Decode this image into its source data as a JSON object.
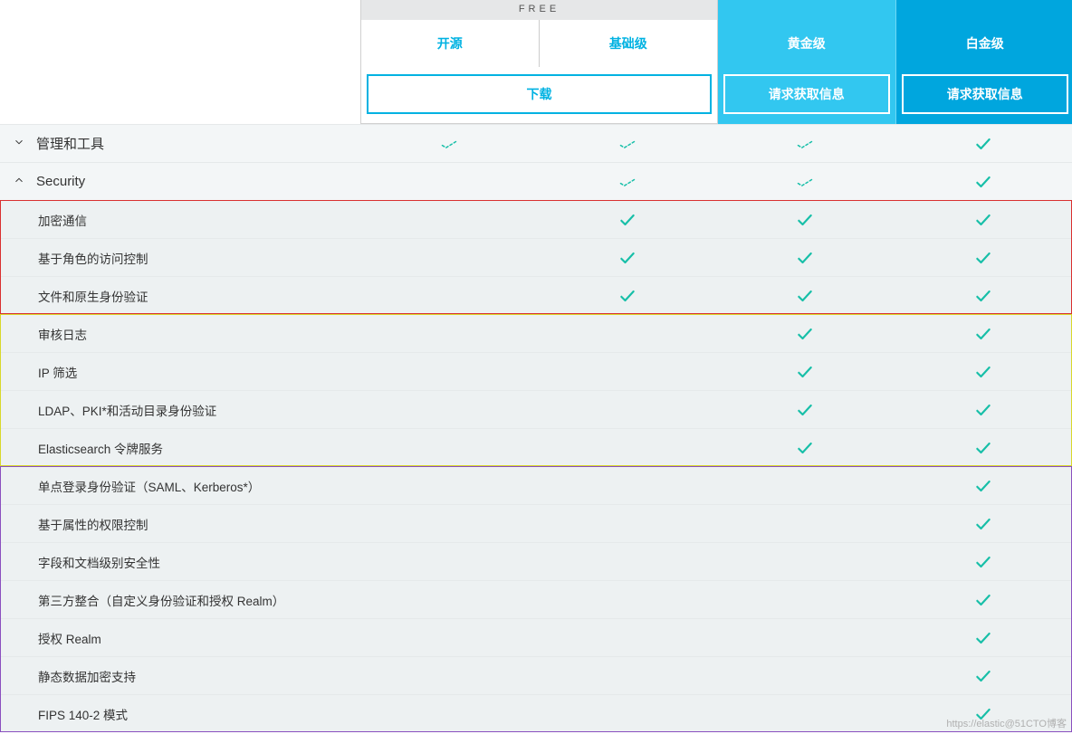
{
  "header": {
    "free_label": "FREE",
    "plans": {
      "open": "开源",
      "basic": "基础级",
      "gold": "黄金级",
      "plat": "白金级"
    },
    "cta": {
      "download": "下载",
      "request": "请求获取信息"
    }
  },
  "sections": [
    {
      "id": "mgmt",
      "label": "管理和工具",
      "expanded": false,
      "cells": [
        "partial",
        "partial",
        "partial",
        "check"
      ]
    },
    {
      "id": "security",
      "label": "Security",
      "expanded": true,
      "cells": [
        "",
        "partial",
        "partial",
        "check"
      ]
    }
  ],
  "features": [
    {
      "group": "red",
      "label": "加密通信",
      "cells": [
        "",
        "check",
        "check",
        "check"
      ]
    },
    {
      "group": "red",
      "label": "基于角色的访问控制",
      "cells": [
        "",
        "check",
        "check",
        "check"
      ]
    },
    {
      "group": "red",
      "label": "文件和原生身份验证",
      "cells": [
        "",
        "check",
        "check",
        "check"
      ]
    },
    {
      "group": "yellow",
      "label": "审核日志",
      "cells": [
        "",
        "",
        "check",
        "check"
      ]
    },
    {
      "group": "yellow",
      "label": "IP 筛选",
      "cells": [
        "",
        "",
        "check",
        "check"
      ]
    },
    {
      "group": "yellow",
      "label": "LDAP、PKI*和活动目录身份验证",
      "cells": [
        "",
        "",
        "check",
        "check"
      ]
    },
    {
      "group": "yellow",
      "label": "Elasticsearch 令牌服务",
      "cells": [
        "",
        "",
        "check",
        "check"
      ]
    },
    {
      "group": "purple",
      "label": "单点登录身份验证（SAML、Kerberos*）",
      "cells": [
        "",
        "",
        "",
        "check"
      ]
    },
    {
      "group": "purple",
      "label": "基于属性的权限控制",
      "cells": [
        "",
        "",
        "",
        "check"
      ]
    },
    {
      "group": "purple",
      "label": "字段和文档级别安全性",
      "cells": [
        "",
        "",
        "",
        "check"
      ]
    },
    {
      "group": "purple",
      "label": "第三方整合（自定义身份验证和授权 Realm）",
      "cells": [
        "",
        "",
        "",
        "check"
      ]
    },
    {
      "group": "purple",
      "label": "授权 Realm",
      "cells": [
        "",
        "",
        "",
        "check"
      ]
    },
    {
      "group": "purple",
      "label": "静态数据加密支持",
      "cells": [
        "",
        "",
        "",
        "check"
      ]
    },
    {
      "group": "purple",
      "label": "FIPS 140-2 模式",
      "cells": [
        "",
        "",
        "",
        "check"
      ]
    }
  ],
  "watermark": "https://elastic@51CTO博客"
}
